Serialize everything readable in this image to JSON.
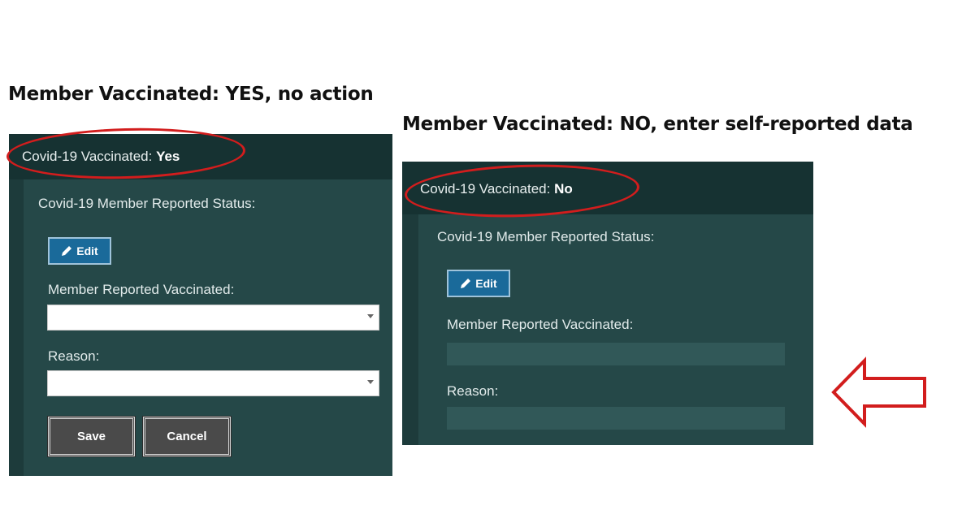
{
  "captions": {
    "left": "Member Vaccinated: YES, no action",
    "right": "Member Vaccinated: NO, enter self-reported data"
  },
  "left_panel": {
    "header_label": "Covid-19 Vaccinated: ",
    "header_value": "Yes",
    "status_title": "Covid-19 Member Reported Status:",
    "edit_label": "Edit",
    "vaccinated_label": "Member Reported Vaccinated:",
    "vaccinated_value": "",
    "reason_label": "Reason:",
    "reason_value": "",
    "save_label": "Save",
    "cancel_label": "Cancel"
  },
  "right_panel": {
    "header_label": "Covid-19 Vaccinated: ",
    "header_value": "No",
    "status_title": "Covid-19 Member Reported Status:",
    "edit_label": "Edit",
    "vaccinated_label": "Member Reported Vaccinated:",
    "reason_label": "Reason:"
  },
  "icons": {
    "edit": "pencil-icon",
    "pointer": "arrow-left-icon"
  },
  "colors": {
    "highlight": "#d21d1d",
    "panel": "#1d3b3b",
    "edit_button": "#1a6a9a"
  }
}
